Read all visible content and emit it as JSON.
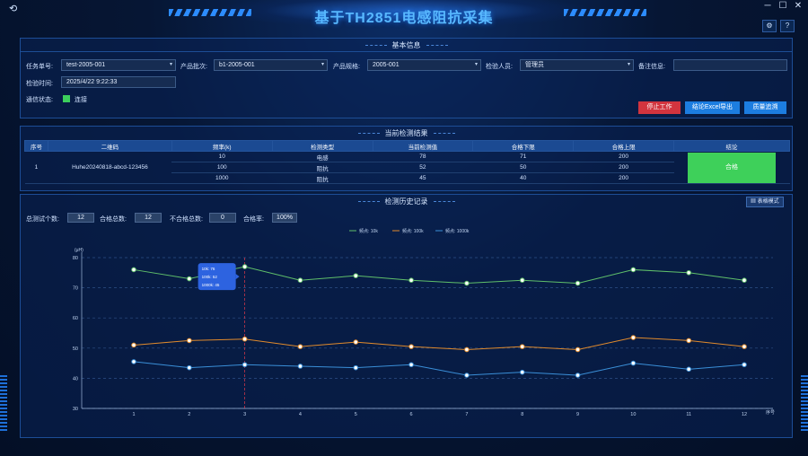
{
  "app": {
    "title": "基于TH2851电感阻抗采集",
    "settings_icon": "gear-icon",
    "help_label": "?",
    "back_icon": "back-arrow-icon",
    "window_controls": [
      "─",
      "☐",
      "✕"
    ]
  },
  "basic_info": {
    "title": "基本信息",
    "task_label": "任务单号:",
    "task_value": "test-2005-001",
    "batch_label": "产品批次:",
    "batch_value": "b1-2005-001",
    "spec_label": "产品规格:",
    "spec_value": "2005-001",
    "inspector_label": "检验人员:",
    "inspector_value": "管理员",
    "remark_label": "备注信息:",
    "remark_value": "",
    "time_label": "检验时间:",
    "time_value": "2025/4/22  9:22:33",
    "comm_label": "通信状态:",
    "comm_value": "连接",
    "stop_button": "停止工作",
    "export_button": "结论Excel导出",
    "trace_button": "质量追溯"
  },
  "current_result": {
    "title": "当前检测结果",
    "headers": [
      "序号",
      "二维码",
      "频率(k)",
      "检测类型",
      "当前检测值",
      "合格下限",
      "合格上限",
      "结论"
    ],
    "index": "1",
    "qrcode": "Huhe20240818-abcd-123456",
    "rows": [
      {
        "freq": "10",
        "type": "电感",
        "value": "78",
        "low": "71",
        "high": "200"
      },
      {
        "freq": "100",
        "type": "阻抗",
        "value": "52",
        "low": "50",
        "high": "200"
      },
      {
        "freq": "1000",
        "type": "阻抗",
        "value": "45",
        "low": "40",
        "high": "200"
      }
    ],
    "conclusion": "合格"
  },
  "history": {
    "title": "检测历史记录",
    "table_mode_button": "表格模式",
    "total_label": "总测试个数:",
    "total_value": "12",
    "pass_label": "合格总数:",
    "pass_value": "12",
    "fail_label": "不合格总数:",
    "fail_value": "0",
    "rate_label": "合格率:",
    "rate_value": "100%",
    "tooltip": {
      "line1": "10k: 76",
      "line2": "100k: 52",
      "line3": "1000k: 45"
    }
  },
  "chart_data": {
    "type": "line",
    "x": [
      1,
      2,
      3,
      4,
      5,
      6,
      7,
      8,
      9,
      10,
      11,
      12
    ],
    "xlabel": "序号",
    "ylabel": "(μH)",
    "ylim": [
      30,
      80
    ],
    "yticks": [
      30,
      40,
      50,
      60,
      70,
      80
    ],
    "legend_position": "top-center",
    "grid": true,
    "hover_index": 3,
    "series": [
      {
        "name": "频点: 10k",
        "color": "#5fbf6a",
        "values": [
          76,
          73,
          77,
          72.5,
          74,
          72.5,
          71.5,
          72.5,
          71.5,
          76,
          75,
          72.5
        ]
      },
      {
        "name": "频点: 100k",
        "color": "#e08a2c",
        "values": [
          51,
          52.5,
          53,
          50.5,
          52,
          50.5,
          49.5,
          50.5,
          49.5,
          53.5,
          52.5,
          50.5
        ]
      },
      {
        "name": "频点: 1000k",
        "color": "#3a8fd8",
        "values": [
          45.5,
          43.5,
          44.5,
          44,
          43.5,
          44.5,
          41,
          42,
          41,
          45,
          43,
          44.5
        ]
      }
    ]
  }
}
